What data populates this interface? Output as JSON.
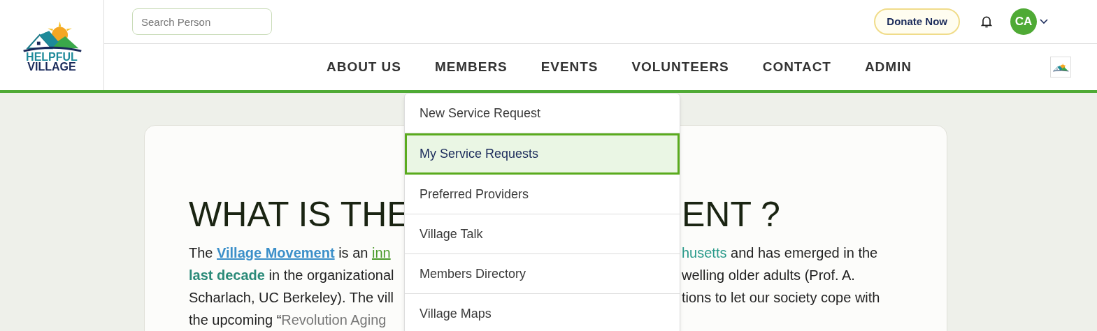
{
  "logo": {
    "line1": "HELPFUL",
    "line2": "VILLAGE"
  },
  "search": {
    "placeholder": "Search Person"
  },
  "donate_button": "Donate Now",
  "avatar": {
    "initials": "CA"
  },
  "nav": [
    {
      "label": "ABOUT US"
    },
    {
      "label": "MEMBERS"
    },
    {
      "label": "EVENTS"
    },
    {
      "label": "VOLUNTEERS"
    },
    {
      "label": "CONTACT"
    },
    {
      "label": "ADMIN"
    }
  ],
  "dropdown": [
    {
      "label": "New Service Request",
      "selected": false
    },
    {
      "label": "My Service Requests",
      "selected": true
    },
    {
      "label": "Preferred Providers",
      "selected": false
    },
    {
      "label": "Village Talk",
      "selected": false
    },
    {
      "label": "Members Directory",
      "selected": false
    },
    {
      "label": "Village Maps",
      "selected": false
    }
  ],
  "article": {
    "title_left": "WHAT IS THE",
    "title_right": "ENT ?",
    "lines": [
      {
        "left": [
          {
            "kind": "plain",
            "text": "The "
          },
          {
            "kind": "link",
            "text": "Village Movement"
          },
          {
            "kind": "plain",
            "text": " is an "
          },
          {
            "kind": "green_link",
            "text": "inn"
          }
        ],
        "right": [
          {
            "kind": "teal_link",
            "text": "husetts"
          },
          {
            "kind": "plain",
            "text": " and has emerged in the"
          }
        ]
      },
      {
        "left": [
          {
            "kind": "bold",
            "text": "last decade"
          },
          {
            "kind": "plain",
            "text": " in the organizational"
          }
        ],
        "right": [
          {
            "kind": "plain",
            "text": "welling older adults (Prof. A."
          }
        ]
      },
      {
        "left": [
          {
            "kind": "plain",
            "text": "Scharlach, UC Berkeley). The vill"
          }
        ],
        "right": [
          {
            "kind": "plain",
            "text": "tions to let our society cope with"
          }
        ]
      },
      {
        "left": [
          {
            "kind": "plain",
            "text": "the upcoming “"
          },
          {
            "kind": "grey",
            "text": "Revolution Aging"
          }
        ]
      }
    ]
  }
}
